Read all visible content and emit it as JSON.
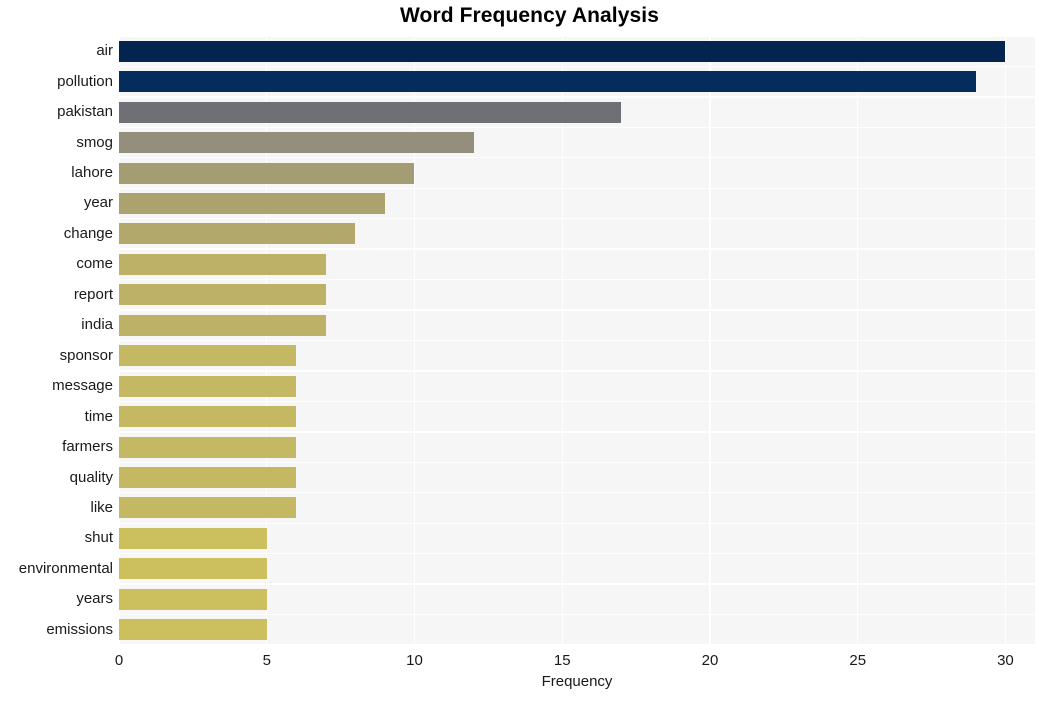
{
  "chart_data": {
    "type": "bar",
    "orientation": "horizontal",
    "title": "Word Frequency Analysis",
    "xlabel": "Frequency",
    "ylabel": "",
    "xlim": [
      0,
      31
    ],
    "ylim": [
      0,
      20
    ],
    "grid": true,
    "legend": null,
    "xticks": [
      "0",
      "5",
      "10",
      "15",
      "20",
      "25",
      "30"
    ],
    "xtick_values": [
      0,
      5,
      10,
      15,
      20,
      25,
      30
    ],
    "categories": [
      "air",
      "pollution",
      "pakistan",
      "smog",
      "lahore",
      "year",
      "change",
      "come",
      "report",
      "india",
      "sponsor",
      "message",
      "time",
      "farmers",
      "quality",
      "like",
      "shut",
      "environmental",
      "years",
      "emissions"
    ],
    "values": [
      30,
      29,
      17,
      12,
      10,
      9,
      8,
      7,
      7,
      7,
      6,
      6,
      6,
      6,
      6,
      6,
      5,
      5,
      5,
      5
    ],
    "bar_colors": [
      "#042450",
      "#042c5c",
      "#6e7076",
      "#938f7c",
      "#a49c72",
      "#aba26e",
      "#b2a86c",
      "#bcb167",
      "#bcb167",
      "#bcb167",
      "#c4b863",
      "#c4b863",
      "#c4b863",
      "#c4b863",
      "#c4b863",
      "#c4b863",
      "#ccbf5e",
      "#ccbf5e",
      "#ccbf5e",
      "#ccbf5e"
    ]
  },
  "style": {
    "plot_background": "#f6f6f6",
    "figure_background": "#ffffff",
    "gridline_color": "#ffffff",
    "text_color": "#1a1a1a",
    "title_color": "#000000"
  }
}
